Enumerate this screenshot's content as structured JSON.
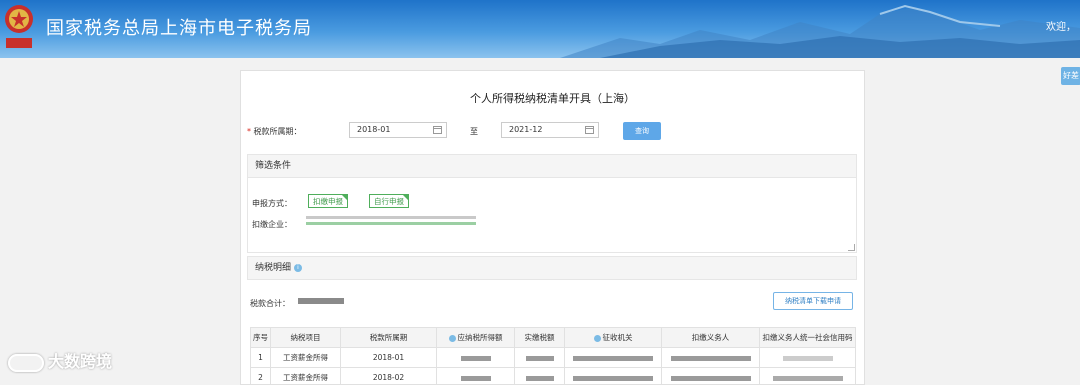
{
  "header": {
    "title": "国家税务总局上海市电子税务局",
    "welcome": "欢迎，",
    "colors": {
      "top": "#1f73c9",
      "bottom": "#8cc3ee"
    }
  },
  "side_button": "好差",
  "page": {
    "title": "个人所得税纳税清单开具（上海）",
    "period_label": "税款所属期：",
    "required_mark": "*",
    "date_from": "2018-01",
    "to_label": "至",
    "date_to": "2021-12",
    "query_button": "查询"
  },
  "filter": {
    "heading": "筛选条件",
    "method_label": "申报方式：",
    "tags": [
      "扣缴申报",
      "自行申报"
    ],
    "company_label": "扣缴企业："
  },
  "details": {
    "heading": "纳税明细",
    "total_label": "税款合计：",
    "download_button": "纳税清单下载申请"
  },
  "table": {
    "headers": [
      "序号",
      "纳税项目",
      "税款所属期",
      "应纳税所得额",
      "实缴税额",
      "征收机关",
      "扣缴义务人",
      "扣缴义务人统一社会信用码"
    ],
    "rows": [
      {
        "index": "1",
        "item": "工资薪金所得",
        "period": "2018-01"
      },
      {
        "index": "2",
        "item": "工资薪金所得",
        "period": "2018-02"
      }
    ]
  },
  "watermark": "大数跨境",
  "icons": [
    "emblem-icon",
    "calendar-icon",
    "info-icon"
  ]
}
